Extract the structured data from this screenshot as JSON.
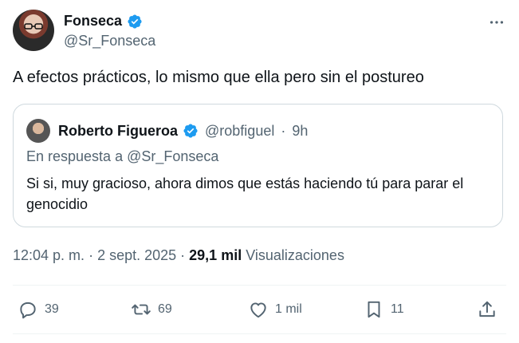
{
  "author": {
    "name": "Fonseca",
    "handle": "@Sr_Fonseca",
    "verified": true
  },
  "tweet": {
    "text": "A efectos prácticos, lo mismo que ella pero sin el postureo"
  },
  "quoted": {
    "name": "Roberto Figueroa",
    "handle": "@robfiguel",
    "separator": "·",
    "age": "9h",
    "reply_to": "En respuesta a @Sr_Fonseca",
    "text": "Si si, muy gracioso, ahora dimos que estás haciendo tú para parar el genocidio"
  },
  "meta": {
    "time": "12:04 p. m.",
    "dot1": "·",
    "date": "2 sept. 2025",
    "dot2": "·",
    "views_count": "29,1 mil",
    "views_label": "Visualizaciones"
  },
  "actions": {
    "replies": "39",
    "retweets": "69",
    "likes": "1 mil",
    "bookmarks": "11"
  },
  "colors": {
    "verified": "#1d9bf0",
    "secondary_text": "#536471",
    "border": "#cfd9de"
  },
  "icons": [
    "verified-badge-icon",
    "more-icon",
    "reply-icon",
    "retweet-icon",
    "like-icon",
    "bookmark-icon",
    "share-icon"
  ]
}
